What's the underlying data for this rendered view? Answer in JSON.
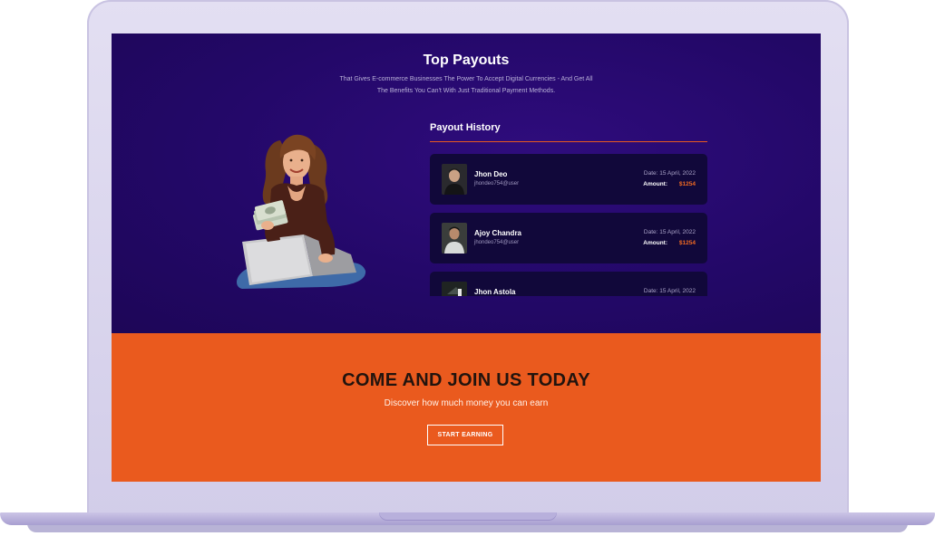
{
  "payouts": {
    "title": "Top Payouts",
    "subtitle_line1": "That Gives E-commerce Businesses The Power To Accept Digital Currencies - And Get All",
    "subtitle_line2": "The Benefits You Can't With Just Traditional Payment Methods.",
    "history_title": "Payout History",
    "items": [
      {
        "name": "Jhon Deo",
        "email": "jhondeo754@user",
        "date": "Date: 15 April, 2022",
        "amount_label": "Amount:",
        "amount": "$1254"
      },
      {
        "name": "Ajoy Chandra",
        "email": "jhondeo754@user",
        "date": "Date: 15 April, 2022",
        "amount_label": "Amount:",
        "amount": "$1254"
      },
      {
        "name": "Jhon Astola",
        "email": "",
        "date": "Date: 15 April, 2022",
        "amount_label": "",
        "amount": ""
      }
    ]
  },
  "cta": {
    "title": "COME AND JOIN US TODAY",
    "subtitle": "Discover how much money you can earn",
    "button_label": "START EARNING"
  },
  "colors": {
    "page_bg": "#250a6b",
    "card_bg": "#11083a",
    "accent": "#ea5a1e",
    "amount": "#f06a22"
  }
}
